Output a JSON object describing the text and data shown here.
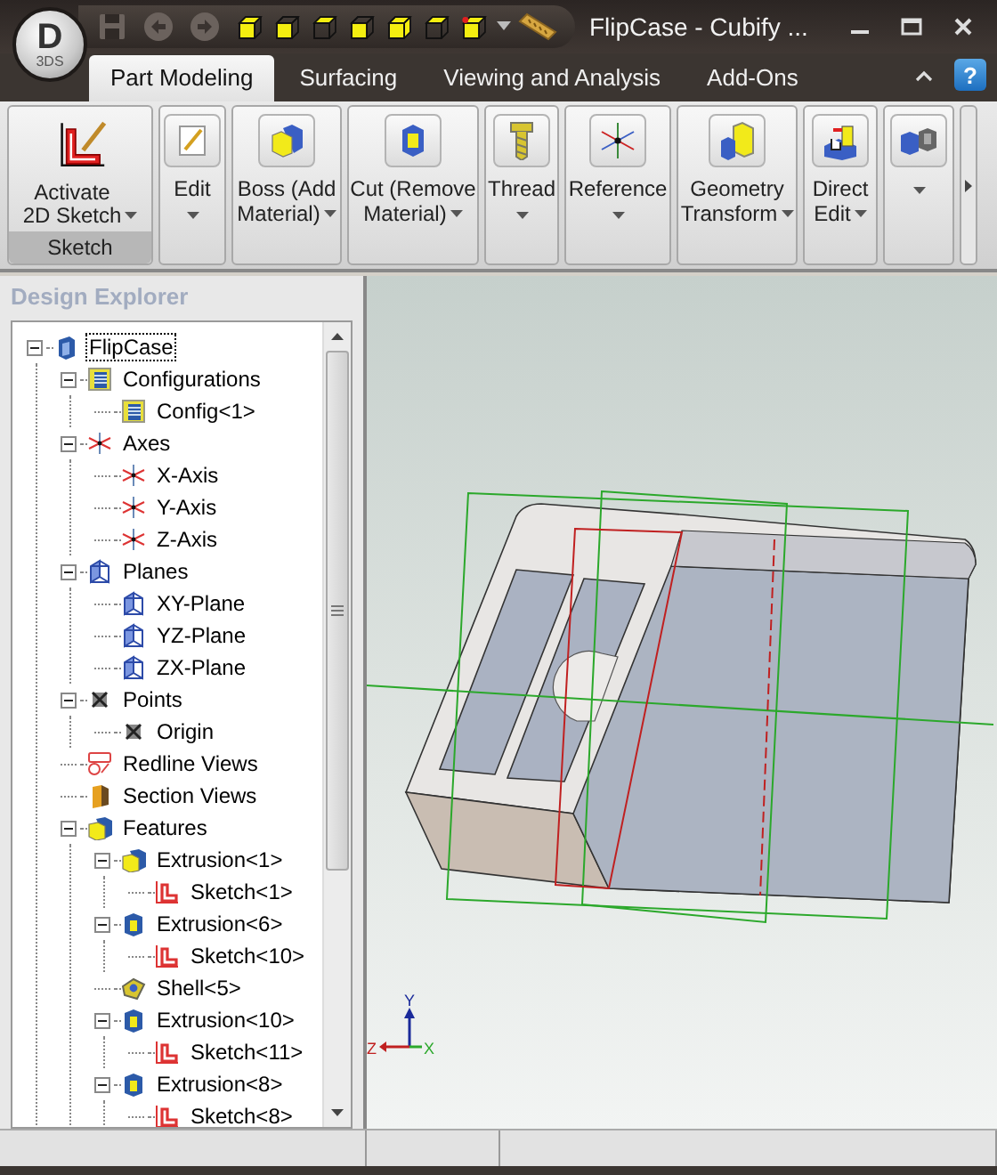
{
  "app_logo": {
    "letter": "D",
    "subtitle": "3DS"
  },
  "quick_access": [
    {
      "kind": "save",
      "disabled": true
    },
    {
      "kind": "undo",
      "disabled": true
    },
    {
      "kind": "redo",
      "disabled": true
    }
  ],
  "window": {
    "title": "FlipCase - Cubify ..."
  },
  "tabs": [
    {
      "label": "Part Modeling",
      "selected": true
    },
    {
      "label": "Surfacing",
      "selected": false
    },
    {
      "label": "Viewing and Analysis",
      "selected": false
    },
    {
      "label": "Add-Ons",
      "selected": false
    }
  ],
  "help_button": "?",
  "ribbon": {
    "sketch_group": {
      "label": "Sketch",
      "button": {
        "label": "Activate\n2D Sketch",
        "kind": "sketch",
        "dropdown": true
      }
    },
    "buttons": [
      {
        "label": "Edit",
        "kind": "edit",
        "dropdown": true
      },
      {
        "label": "Boss (Add\nMaterial)",
        "kind": "boss",
        "dropdown": true
      },
      {
        "label": "Cut (Remove\nMaterial)",
        "kind": "cut",
        "dropdown": true
      },
      {
        "label": "Thread",
        "kind": "thread",
        "dropdown": true
      },
      {
        "label": "Reference",
        "kind": "reference",
        "dropdown": true
      },
      {
        "label": "Geometry\nTransform",
        "kind": "transform",
        "dropdown": true
      },
      {
        "label": "Direct\nEdit",
        "kind": "direct",
        "dropdown": true
      },
      {
        "kind": "solids",
        "dropdown": true
      }
    ]
  },
  "design_explorer": {
    "title": "Design Explorer",
    "tree": [
      {
        "label": "FlipCase",
        "kind": "part",
        "selected": true,
        "expanded": true,
        "children": [
          {
            "label": "Configurations",
            "kind": "configs",
            "selected": false,
            "expanded": true,
            "children": [
              {
                "label": "Config<1>",
                "kind": "config",
                "selected": false
              }
            ]
          },
          {
            "label": "Axes",
            "kind": "axis",
            "selected": false,
            "expanded": true,
            "children": [
              {
                "label": "X-Axis",
                "kind": "axis",
                "selected": false
              },
              {
                "label": "Y-Axis",
                "kind": "axis",
                "selected": false
              },
              {
                "label": "Z-Axis",
                "kind": "axis",
                "selected": false
              }
            ]
          },
          {
            "label": "Planes",
            "kind": "plane",
            "selected": false,
            "expanded": true,
            "children": [
              {
                "label": "XY-Plane",
                "kind": "plane",
                "selected": false
              },
              {
                "label": "YZ-Plane",
                "kind": "plane",
                "selected": false
              },
              {
                "label": "ZX-Plane",
                "kind": "plane",
                "selected": false
              }
            ]
          },
          {
            "label": "Points",
            "kind": "point",
            "selected": false,
            "expanded": true,
            "children": [
              {
                "label": "Origin",
                "kind": "point",
                "selected": false
              }
            ]
          },
          {
            "label": "Redline Views",
            "kind": "redline",
            "selected": false
          },
          {
            "label": "Section Views",
            "kind": "section",
            "selected": false
          },
          {
            "label": "Features",
            "kind": "features",
            "selected": false,
            "expanded": true,
            "children": [
              {
                "label": "Extrusion<1>",
                "kind": "boss",
                "selected": false,
                "expanded": true,
                "children": [
                  {
                    "label": "Sketch<1>",
                    "kind": "sketch",
                    "selected": false
                  }
                ]
              },
              {
                "label": "Extrusion<6>",
                "kind": "cut",
                "selected": false,
                "expanded": true,
                "children": [
                  {
                    "label": "Sketch<10>",
                    "kind": "sketch",
                    "selected": false
                  }
                ]
              },
              {
                "label": "Shell<5>",
                "kind": "shell",
                "selected": false
              },
              {
                "label": "Extrusion<10>",
                "kind": "cut",
                "selected": false,
                "expanded": true,
                "children": [
                  {
                    "label": "Sketch<11>",
                    "kind": "sketch",
                    "selected": false
                  }
                ]
              },
              {
                "label": "Extrusion<8>",
                "kind": "cut",
                "selected": false,
                "expanded": true,
                "children": [
                  {
                    "label": "Sketch<8>",
                    "kind": "sketch",
                    "selected": false
                  }
                ]
              }
            ]
          }
        ]
      }
    ]
  },
  "viewport": {
    "triad": {
      "x": "X",
      "y": "Y",
      "z": "Z"
    }
  }
}
